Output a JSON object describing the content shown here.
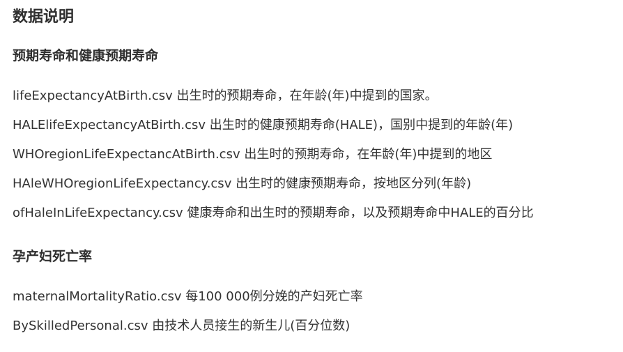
{
  "page_title": "数据说明",
  "sections": [
    {
      "heading": "预期寿命和健康预期寿命",
      "items": [
        "lifeExpectancyAtBirth.csv 出生时的预期寿命，在年龄(年)中提到的国家。",
        "HALElifeExpectancyAtBirth.csv 出生时的健康预期寿命(HALE)，国别中提到的年龄(年)",
        "WHOregionLifeExpectancAtBirth.csv 出生时的预期寿命，在年龄(年)中提到的地区",
        "HAleWHOregionLifeExpectancy.csv 出生时的健康预期寿命，按地区分列(年龄)",
        "ofHaleInLifeExpectancy.csv 健康寿命和出生时的预期寿命，以及预期寿命中HALE的百分比"
      ]
    },
    {
      "heading": "孕产妇死亡率",
      "items": [
        "maternalMortalityRatio.csv 每100 000例分娩的产妇死亡率",
        "BySkilledPersonal.csv 由技术人员接生的新生儿(百分位数)"
      ]
    }
  ]
}
